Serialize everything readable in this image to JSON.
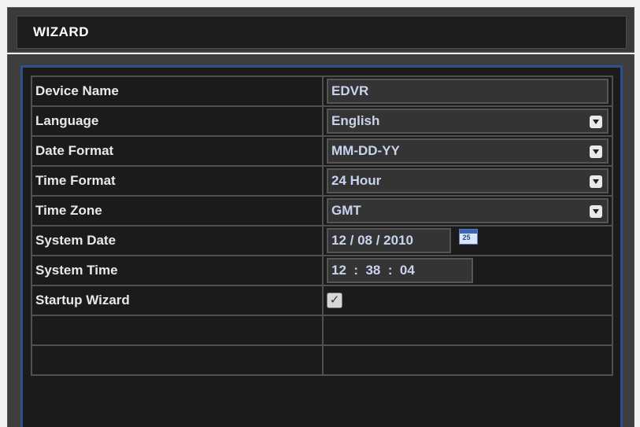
{
  "window": {
    "title": "WIZARD"
  },
  "form": {
    "device_name_label": "Device Name",
    "device_name_value": "EDVR",
    "language_label": "Language",
    "language_value": "English",
    "date_format_label": "Date Format",
    "date_format_value": "MM-DD-YY",
    "time_format_label": "Time Format",
    "time_format_value": "24 Hour",
    "time_zone_label": "Time Zone",
    "time_zone_value": "GMT",
    "system_date_label": "System Date",
    "system_date_value": "12 / 08 / 2010",
    "calendar_icon_text": "25",
    "system_time_label": "System Time",
    "system_time_value": "12  :  38  :  04",
    "startup_wizard_label": "Startup Wizard",
    "startup_wizard_checked": true,
    "checkbox_mark": "✓"
  },
  "icons": {
    "dropdown": "chevron-down-icon",
    "calendar": "calendar-icon",
    "checkbox": "checkmark-icon"
  },
  "colors": {
    "frame_accent": "#2f4f8f",
    "panel_bg": "#1b1b1b",
    "value_text": "#c8d4ee"
  }
}
